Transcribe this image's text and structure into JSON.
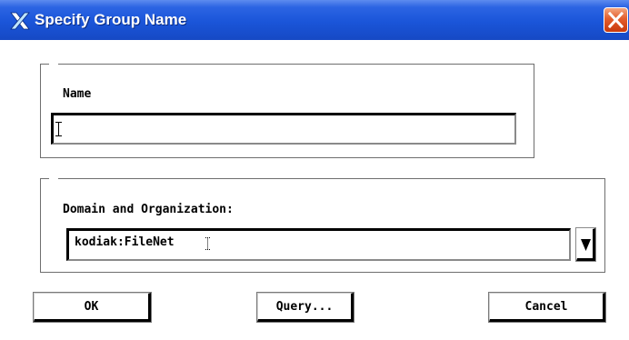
{
  "window": {
    "title": "Specify Group Name",
    "app_icon": "x-logo-icon",
    "close_icon": "close-icon",
    "accent_color": "#2c64e3",
    "close_color": "#e35d2c"
  },
  "name_group": {
    "label": "Name",
    "value": "",
    "placeholder": ""
  },
  "domain_group": {
    "label": "Domain and Organization:",
    "selected_value": "kodiak:FileNet",
    "dropdown_icon": "dropdown-arrow-icon"
  },
  "buttons": {
    "ok": "OK",
    "query": "Query...",
    "cancel": "Cancel"
  }
}
